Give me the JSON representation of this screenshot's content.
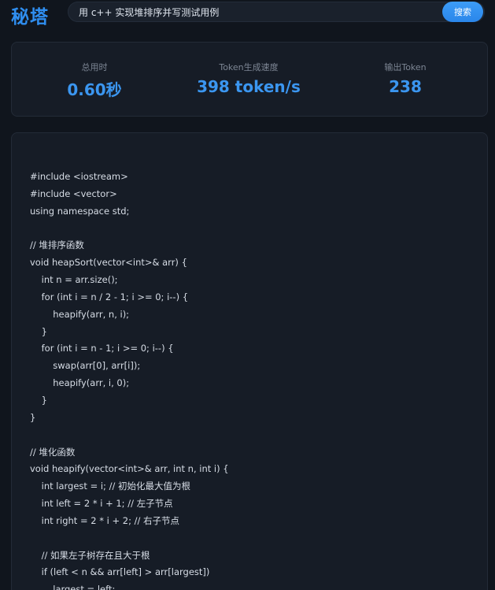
{
  "header": {
    "logo": "秘塔",
    "search_value": "用 c++ 实现堆排序并写测试用例",
    "search_button": "搜索"
  },
  "stats": [
    {
      "label": "总用时",
      "value": "0.60秒"
    },
    {
      "label": "Token生成速度",
      "value": "398 token/s"
    },
    {
      "label": "输出Token",
      "value": "238"
    }
  ],
  "code": {
    "lines": [
      "#include <iostream>",
      "#include <vector>",
      "using namespace std;",
      "",
      "// 堆排序函数",
      "void heapSort(vector<int>& arr) {",
      "    int n = arr.size();",
      "    for (int i = n / 2 - 1; i >= 0; i--) {",
      "        heapify(arr, n, i);",
      "    }",
      "    for (int i = n - 1; i >= 0; i--) {",
      "        swap(arr[0], arr[i]);",
      "        heapify(arr, i, 0);",
      "    }",
      "}",
      "",
      "// 堆化函数",
      "void heapify(vector<int>& arr, int n, int i) {",
      "    int largest = i; // 初始化最大值为根",
      "    int left = 2 * i + 1; // 左子节点",
      "    int right = 2 * i + 2; // 右子节点",
      "",
      "    // 如果左子树存在且大于根",
      "    if (left < n && arr[left] > arr[largest])",
      "        largest = left;"
    ]
  },
  "colors": {
    "accent": "#3b96f0",
    "background": "#10151d",
    "card": "#161c26"
  }
}
